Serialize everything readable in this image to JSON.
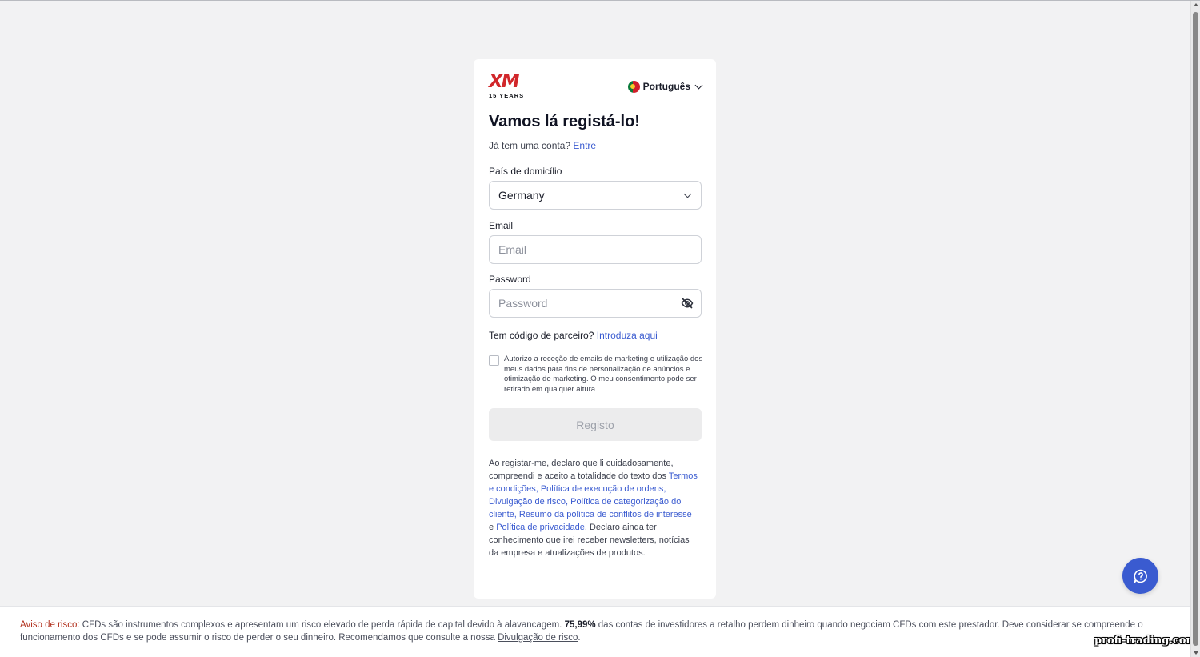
{
  "header": {
    "logo_text": "XM",
    "logo_subtext": "15 YEARS",
    "language": "Português"
  },
  "form": {
    "title": "Vamos lá registá-lo!",
    "login_prompt": "Já tem uma conta?",
    "login_link": "Entre",
    "country_label": "País de domicílio",
    "country_value": "Germany",
    "email_label": "Email",
    "email_placeholder": "Email",
    "email_value": "",
    "password_label": "Password",
    "password_placeholder": "Password",
    "password_value": "",
    "partner_prompt": "Tem código de parceiro?",
    "partner_link": "Introduza aqui",
    "consent_text": "Autorizo a receção de emails de marketing e utilização dos meus dados para fins de personalização de anúncios e otimização de marketing. O meu consentimento pode ser retirado em qualquer altura.",
    "consent_checked": false,
    "register_label": "Registo"
  },
  "legal": {
    "intro": "Ao registar-me, declaro que li cuidadosamente, compreendi e aceito a totalidade do texto dos ",
    "link_terms": "Termos e condições",
    "sep1": ", ",
    "link_execution": "Política de execução de ordens",
    "sep2": ", ",
    "link_risk": "Divulgação de risco",
    "sep3": ", ",
    "link_categorization": "Política de categorização do cliente",
    "sep4": ", ",
    "link_conflicts": "Resumo da política de conflitos de interesse",
    "and": " e ",
    "link_privacy": "Política de privacidade",
    "outro": ". Declaro ainda ter conhecimento que irei receber newsletters, notícias da empresa e atualizações de produtos."
  },
  "risk_warning": {
    "label": "Aviso de risco:",
    "text1": " CFDs são instrumentos complexos e apresentam um risco elevado de perda rápida de capital devido à alavancagem. ",
    "percent": "75,99%",
    "text2": " das contas de investidores a retalho perdem dinheiro quando negociam CFDs com este prestador. Deve considerar se compreende o funcionamento dos CFDs e se pode assumir o risco de perder o seu dinheiro. Recomendamos que consulte a nossa ",
    "link": "Divulgação de risco",
    "end": "."
  },
  "watermark": "profi-trading.com",
  "colors": {
    "accent": "#3a5bd0",
    "risk_label": "#b2321f",
    "brand_red": "#d1272b",
    "page_bg": "#f2f2f3"
  }
}
